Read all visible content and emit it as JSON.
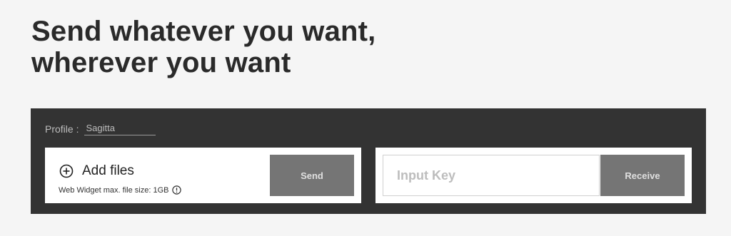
{
  "hero": {
    "title_line1": "Send whatever you want,",
    "title_line2": "wherever you want"
  },
  "profile": {
    "label": "Profile :",
    "value": "Sagitta"
  },
  "send": {
    "add_files_label": "Add files",
    "add_files_icon": "plus-circle-icon",
    "max_size_text": "Web Widget max. file size: 1GB",
    "info_icon": "info-icon",
    "button_label": "Send"
  },
  "receive": {
    "key_placeholder": "Input Key",
    "button_label": "Receive"
  },
  "colors": {
    "page_background": "#f5f5f5",
    "panel_background": "#333333",
    "button_background": "#757575",
    "title_text": "#2a2a2a"
  }
}
